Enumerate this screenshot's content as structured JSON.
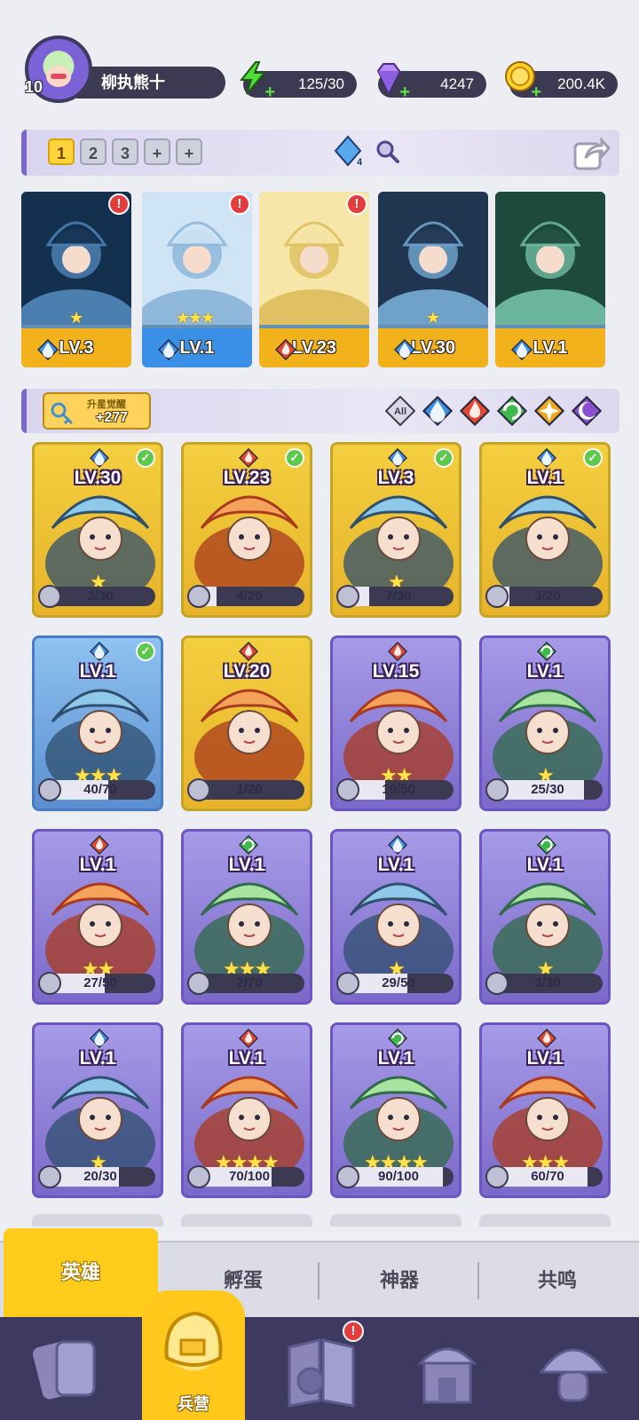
{
  "player": {
    "level": "10",
    "name": "柳执熊十"
  },
  "resources": {
    "energy": "125/30",
    "gems": "4247",
    "coins": "200.4K"
  },
  "team": {
    "slots": [
      "1",
      "2",
      "3",
      "+",
      "+"
    ],
    "active_slot": 0,
    "gem_count": "4",
    "members": [
      {
        "level": "LV.3",
        "element": "water",
        "stars": 1,
        "bar": "gold",
        "alert": true
      },
      {
        "level": "LV.1",
        "element": "water",
        "stars": 3,
        "bar": "blue",
        "alert": true
      },
      {
        "level": "LV.23",
        "element": "fire",
        "stars": 0,
        "bar": "gold",
        "alert": true
      },
      {
        "level": "LV.30",
        "element": "water",
        "stars": 1,
        "bar": "gold",
        "alert": false
      },
      {
        "level": "LV.1",
        "element": "water",
        "stars": 0,
        "bar": "gold",
        "alert": false
      }
    ]
  },
  "awaken": {
    "label": "升星觉醒",
    "count": "+277"
  },
  "filters": [
    {
      "name": "all",
      "label": "All"
    },
    {
      "name": "water"
    },
    {
      "name": "fire"
    },
    {
      "name": "wind"
    },
    {
      "name": "light"
    },
    {
      "name": "dark"
    }
  ],
  "heroes": [
    {
      "level": "LV.30",
      "element": "water",
      "stars": 1,
      "shards": "3/30",
      "progress": 0.1,
      "owned": true,
      "frame": "gold"
    },
    {
      "level": "LV.23",
      "element": "fire",
      "stars": 0,
      "shards": "4/20",
      "progress": 0.2,
      "owned": true,
      "frame": "gold"
    },
    {
      "level": "LV.3",
      "element": "water",
      "stars": 1,
      "shards": "7/30",
      "progress": 0.23,
      "owned": true,
      "frame": "gold"
    },
    {
      "level": "LV.1",
      "element": "water",
      "stars": 0,
      "shards": "3/20",
      "progress": 0.15,
      "owned": true,
      "frame": "gold"
    },
    {
      "level": "LV.1",
      "element": "water",
      "stars": 3,
      "shards": "40/70",
      "progress": 0.57,
      "owned": true,
      "frame": "blue"
    },
    {
      "level": "LV.20",
      "element": "fire",
      "stars": 0,
      "shards": "1/20",
      "progress": 0.05,
      "owned": false,
      "frame": "gold"
    },
    {
      "level": "LV.15",
      "element": "fire",
      "stars": 2,
      "shards": "19/50",
      "progress": 0.38,
      "owned": false,
      "frame": "purple"
    },
    {
      "level": "LV.1",
      "element": "wind",
      "stars": 1,
      "shards": "25/30",
      "progress": 0.83,
      "owned": false,
      "frame": "purple"
    },
    {
      "level": "LV.1",
      "element": "fire",
      "stars": 2,
      "shards": "27/50",
      "progress": 0.54,
      "owned": false,
      "frame": "purple"
    },
    {
      "level": "LV.1",
      "element": "wind",
      "stars": 3,
      "shards": "2/70",
      "progress": 0.03,
      "owned": false,
      "frame": "purple"
    },
    {
      "level": "LV.1",
      "element": "water",
      "stars": 1,
      "shards": "29/50",
      "progress": 0.58,
      "owned": false,
      "frame": "purple"
    },
    {
      "level": "LV.1",
      "element": "wind",
      "stars": 1,
      "shards": "3/30",
      "progress": 0.1,
      "owned": false,
      "frame": "purple"
    },
    {
      "level": "LV.1",
      "element": "water",
      "stars": 1,
      "shards": "20/30",
      "progress": 0.67,
      "owned": false,
      "frame": "purple"
    },
    {
      "level": "LV.1",
      "element": "fire",
      "stars": 4,
      "shards": "70/100",
      "progress": 0.7,
      "owned": false,
      "frame": "purple"
    },
    {
      "level": "LV.1",
      "element": "wind",
      "stars": 4,
      "shards": "90/100",
      "progress": 0.9,
      "owned": false,
      "frame": "purple"
    },
    {
      "level": "LV.1",
      "element": "fire",
      "stars": 3,
      "shards": "60/70",
      "progress": 0.86,
      "owned": false,
      "frame": "purple"
    }
  ],
  "sub_tabs": [
    "英雄",
    "孵蛋",
    "神器",
    "共鸣"
  ],
  "nav": {
    "active_label": "兵营",
    "alert_on": "map"
  },
  "colors": {
    "water": "#3a8fe6",
    "fire": "#e2492e",
    "wind": "#3fb94c",
    "light": "#f2a81d",
    "dark": "#8a4fd1",
    "gold_frame": "#f3cf3f",
    "purple_frame": "#8f80d8",
    "nav_bg": "#3d3960",
    "accent": "#ffcc1c"
  }
}
